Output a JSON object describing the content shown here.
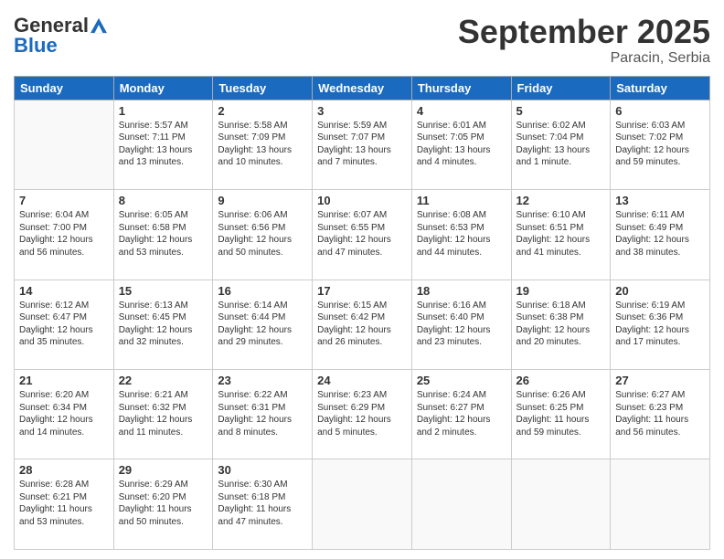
{
  "header": {
    "logo_general": "General",
    "logo_blue": "Blue",
    "month_title": "September 2025",
    "location": "Paracin, Serbia"
  },
  "days_of_week": [
    "Sunday",
    "Monday",
    "Tuesday",
    "Wednesday",
    "Thursday",
    "Friday",
    "Saturday"
  ],
  "weeks": [
    [
      {
        "day": "",
        "info": ""
      },
      {
        "day": "1",
        "info": "Sunrise: 5:57 AM\nSunset: 7:11 PM\nDaylight: 13 hours\nand 13 minutes."
      },
      {
        "day": "2",
        "info": "Sunrise: 5:58 AM\nSunset: 7:09 PM\nDaylight: 13 hours\nand 10 minutes."
      },
      {
        "day": "3",
        "info": "Sunrise: 5:59 AM\nSunset: 7:07 PM\nDaylight: 13 hours\nand 7 minutes."
      },
      {
        "day": "4",
        "info": "Sunrise: 6:01 AM\nSunset: 7:05 PM\nDaylight: 13 hours\nand 4 minutes."
      },
      {
        "day": "5",
        "info": "Sunrise: 6:02 AM\nSunset: 7:04 PM\nDaylight: 13 hours\nand 1 minute."
      },
      {
        "day": "6",
        "info": "Sunrise: 6:03 AM\nSunset: 7:02 PM\nDaylight: 12 hours\nand 59 minutes."
      }
    ],
    [
      {
        "day": "7",
        "info": "Sunrise: 6:04 AM\nSunset: 7:00 PM\nDaylight: 12 hours\nand 56 minutes."
      },
      {
        "day": "8",
        "info": "Sunrise: 6:05 AM\nSunset: 6:58 PM\nDaylight: 12 hours\nand 53 minutes."
      },
      {
        "day": "9",
        "info": "Sunrise: 6:06 AM\nSunset: 6:56 PM\nDaylight: 12 hours\nand 50 minutes."
      },
      {
        "day": "10",
        "info": "Sunrise: 6:07 AM\nSunset: 6:55 PM\nDaylight: 12 hours\nand 47 minutes."
      },
      {
        "day": "11",
        "info": "Sunrise: 6:08 AM\nSunset: 6:53 PM\nDaylight: 12 hours\nand 44 minutes."
      },
      {
        "day": "12",
        "info": "Sunrise: 6:10 AM\nSunset: 6:51 PM\nDaylight: 12 hours\nand 41 minutes."
      },
      {
        "day": "13",
        "info": "Sunrise: 6:11 AM\nSunset: 6:49 PM\nDaylight: 12 hours\nand 38 minutes."
      }
    ],
    [
      {
        "day": "14",
        "info": "Sunrise: 6:12 AM\nSunset: 6:47 PM\nDaylight: 12 hours\nand 35 minutes."
      },
      {
        "day": "15",
        "info": "Sunrise: 6:13 AM\nSunset: 6:45 PM\nDaylight: 12 hours\nand 32 minutes."
      },
      {
        "day": "16",
        "info": "Sunrise: 6:14 AM\nSunset: 6:44 PM\nDaylight: 12 hours\nand 29 minutes."
      },
      {
        "day": "17",
        "info": "Sunrise: 6:15 AM\nSunset: 6:42 PM\nDaylight: 12 hours\nand 26 minutes."
      },
      {
        "day": "18",
        "info": "Sunrise: 6:16 AM\nSunset: 6:40 PM\nDaylight: 12 hours\nand 23 minutes."
      },
      {
        "day": "19",
        "info": "Sunrise: 6:18 AM\nSunset: 6:38 PM\nDaylight: 12 hours\nand 20 minutes."
      },
      {
        "day": "20",
        "info": "Sunrise: 6:19 AM\nSunset: 6:36 PM\nDaylight: 12 hours\nand 17 minutes."
      }
    ],
    [
      {
        "day": "21",
        "info": "Sunrise: 6:20 AM\nSunset: 6:34 PM\nDaylight: 12 hours\nand 14 minutes."
      },
      {
        "day": "22",
        "info": "Sunrise: 6:21 AM\nSunset: 6:32 PM\nDaylight: 12 hours\nand 11 minutes."
      },
      {
        "day": "23",
        "info": "Sunrise: 6:22 AM\nSunset: 6:31 PM\nDaylight: 12 hours\nand 8 minutes."
      },
      {
        "day": "24",
        "info": "Sunrise: 6:23 AM\nSunset: 6:29 PM\nDaylight: 12 hours\nand 5 minutes."
      },
      {
        "day": "25",
        "info": "Sunrise: 6:24 AM\nSunset: 6:27 PM\nDaylight: 12 hours\nand 2 minutes."
      },
      {
        "day": "26",
        "info": "Sunrise: 6:26 AM\nSunset: 6:25 PM\nDaylight: 11 hours\nand 59 minutes."
      },
      {
        "day": "27",
        "info": "Sunrise: 6:27 AM\nSunset: 6:23 PM\nDaylight: 11 hours\nand 56 minutes."
      }
    ],
    [
      {
        "day": "28",
        "info": "Sunrise: 6:28 AM\nSunset: 6:21 PM\nDaylight: 11 hours\nand 53 minutes."
      },
      {
        "day": "29",
        "info": "Sunrise: 6:29 AM\nSunset: 6:20 PM\nDaylight: 11 hours\nand 50 minutes."
      },
      {
        "day": "30",
        "info": "Sunrise: 6:30 AM\nSunset: 6:18 PM\nDaylight: 11 hours\nand 47 minutes."
      },
      {
        "day": "",
        "info": ""
      },
      {
        "day": "",
        "info": ""
      },
      {
        "day": "",
        "info": ""
      },
      {
        "day": "",
        "info": ""
      }
    ]
  ]
}
